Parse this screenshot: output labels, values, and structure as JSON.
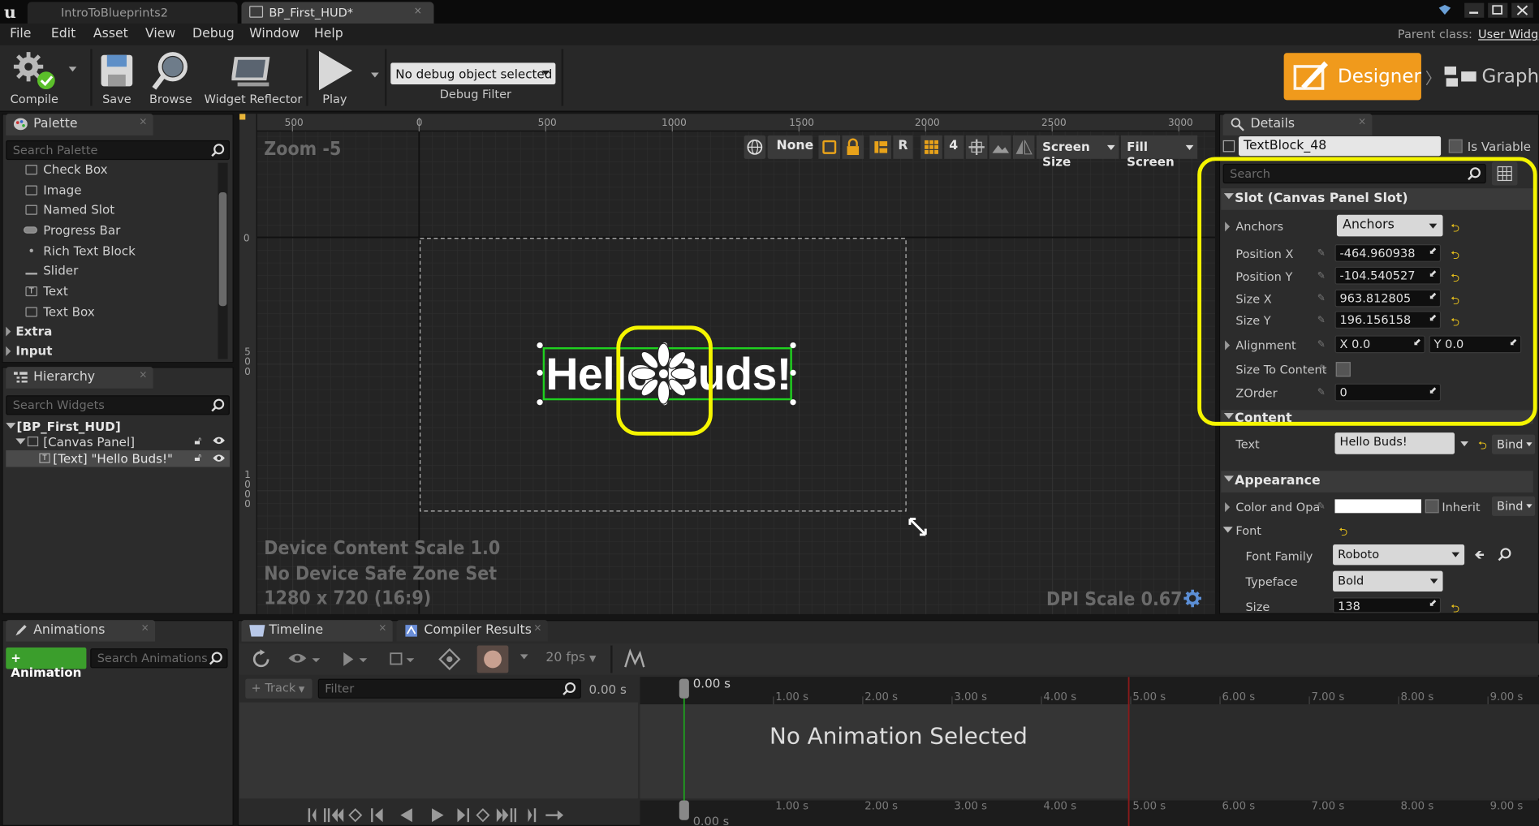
{
  "titlebar": {
    "tabs": [
      "IntroToBlueprints2",
      "BP_First_HUD*"
    ]
  },
  "menu": [
    "File",
    "Edit",
    "Asset",
    "View",
    "Debug",
    "Window",
    "Help"
  ],
  "parent_class": {
    "label": "Parent class:",
    "value": "User Widg"
  },
  "toolbar": {
    "compile": "Compile",
    "save": "Save",
    "browse": "Browse",
    "widget_reflector": "Widget Reflector",
    "play": "Play",
    "debug_object": "No debug object selected",
    "debug_filter": "Debug Filter"
  },
  "mode": {
    "designer": "Designer",
    "graph": "Graph"
  },
  "palette": {
    "tab": "Palette",
    "search_placeholder": "Search Palette",
    "items": [
      "Check Box",
      "Image",
      "Named Slot",
      "Progress Bar",
      "Rich Text Block",
      "Slider",
      "Text",
      "Text Box"
    ],
    "categories": [
      "Extra",
      "Input"
    ]
  },
  "hierarchy": {
    "tab": "Hierarchy",
    "search_placeholder": "Search Widgets",
    "root": "[BP_First_HUD]",
    "canvas": "[Canvas Panel]",
    "text": "[Text] \"Hello Buds!\""
  },
  "designer": {
    "zoom": "Zoom -5",
    "ruler_top": [
      "500",
      "0",
      "500",
      "1000",
      "1500",
      "2000",
      "2500",
      "3000"
    ],
    "ruler_left": [
      "0",
      "5\n0\n0",
      "1\n0\n0\n0"
    ],
    "toolbar": {
      "locale": "None",
      "r": "R",
      "grid": "4",
      "screen_size": "Screen Size",
      "fill_screen": "Fill Screen"
    },
    "widget_text": "Hello Buds!",
    "info": [
      "Device Content Scale 1.0",
      "No Device Safe Zone Set",
      "1280 x 720 (16:9)"
    ],
    "dpi": "DPI Scale 0.67"
  },
  "details": {
    "tab": "Details",
    "name": "TextBlock_48",
    "is_variable": "Is Variable",
    "search_placeholder": "Search",
    "slot_section": "Slot (Canvas Panel Slot)",
    "anchors_label": "Anchors",
    "anchors_value": "Anchors",
    "position_x_label": "Position X",
    "position_x": "-464.960938",
    "position_y_label": "Position Y",
    "position_y": "-104.540527",
    "size_x_label": "Size X",
    "size_x": "963.812805",
    "size_y_label": "Size Y",
    "size_y": "196.156158",
    "alignment_label": "Alignment",
    "alignment_x": "X  0.0",
    "alignment_y": "Y  0.0",
    "size_to_content_label": "Size To Content",
    "zorder_label": "ZOrder",
    "zorder": "0",
    "content_section": "Content",
    "text_label": "Text",
    "text_value": "Hello Buds!",
    "bind": "Bind",
    "appearance_section": "Appearance",
    "color_label": "Color and Opa",
    "inherit": "Inherit",
    "font_label": "Font",
    "font_family_label": "Font Family",
    "font_family": "Roboto",
    "typeface_label": "Typeface",
    "typeface": "Bold",
    "size_label": "Size",
    "size": "138"
  },
  "bottom": {
    "animations_tab": "Animations",
    "add_animation": "+ Animation",
    "search_animations": "Search Animations",
    "timeline_tab": "Timeline",
    "compiler_tab": "Compiler Results",
    "fps": "20 fps",
    "track": "+ Track",
    "filter_placeholder": "Filter",
    "time": "0.00 s",
    "cursor_time": "0.00 s",
    "ticks": [
      "1.00 s",
      "2.00 s",
      "3.00 s",
      "4.00 s",
      "5.00 s",
      "6.00 s",
      "7.00 s",
      "8.00 s",
      "9.00 s"
    ],
    "no_animation": "No Animation Selected"
  },
  "colors": {
    "accent": "#e8b53a",
    "designer_btn": "#f09a1c",
    "highlight": "#f5f500",
    "selection": "#1fd01f"
  }
}
